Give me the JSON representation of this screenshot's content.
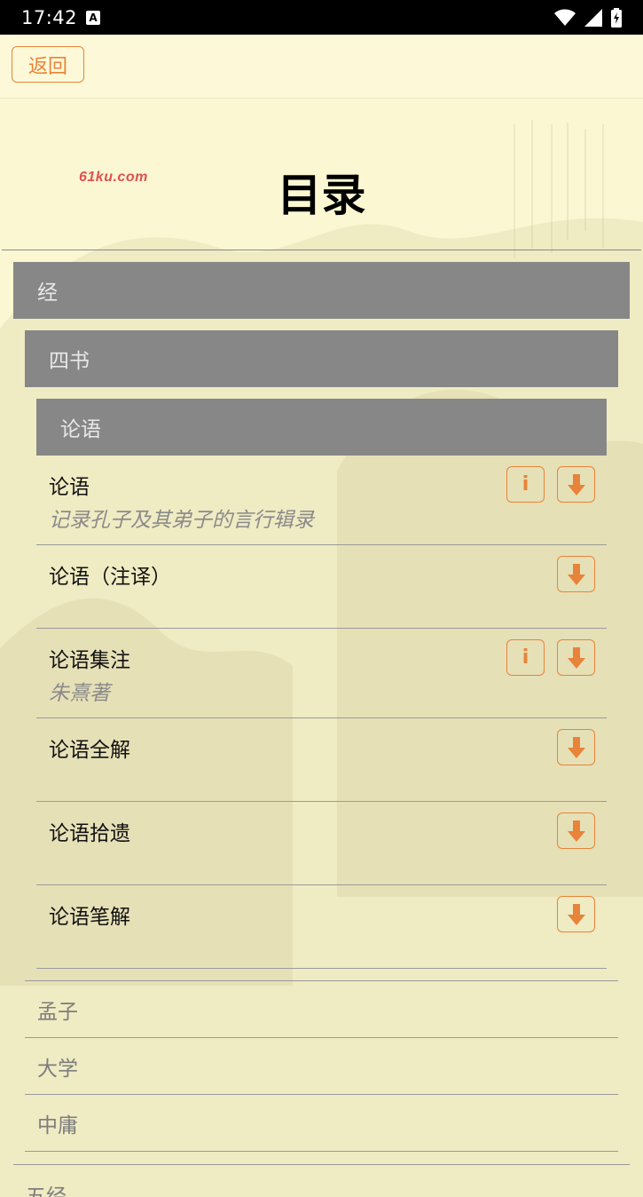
{
  "status_bar": {
    "time": "17:42",
    "notification_badge": "A"
  },
  "topbar": {
    "back_label": "返回"
  },
  "watermark": "61ku.com",
  "page_title": "目录",
  "categories": {
    "level1": "经",
    "level2": "四书",
    "level3": "论语"
  },
  "books": [
    {
      "title": "论语",
      "subtitle": "记录孔子及其弟子的言行辑录",
      "has_info": true
    },
    {
      "title": "论语（注译）",
      "subtitle": "",
      "has_info": false
    },
    {
      "title": "论语集注",
      "subtitle": "朱熹著",
      "has_info": true
    },
    {
      "title": "论语全解",
      "subtitle": "",
      "has_info": false
    },
    {
      "title": "论语拾遗",
      "subtitle": "",
      "has_info": false
    },
    {
      "title": "论语笔解",
      "subtitle": "",
      "has_info": false
    }
  ],
  "sub_categories": [
    "孟子",
    "大学",
    "中庸"
  ],
  "next_main_category": "五经",
  "icons": {
    "info": "i",
    "download": "download-arrow-icon"
  },
  "colors": {
    "accent": "#e8833a",
    "category_bar": "#878787",
    "background": "#fbf7d2"
  }
}
